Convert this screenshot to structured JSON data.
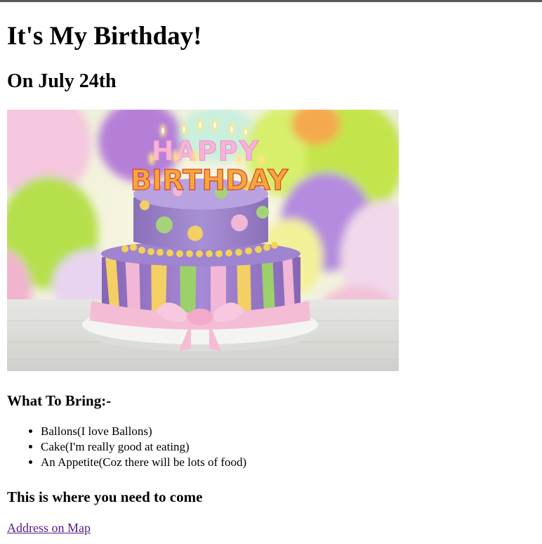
{
  "page": {
    "title": "It's My Birthday!",
    "subtitle": "On July 24th",
    "image": {
      "description_icon": "birthday-cake-icon",
      "cake_text_line1": "HAPPY",
      "cake_text_line2": "BIRTHDAY"
    },
    "bring_heading": "What To Bring:-",
    "bring_items": [
      "Ballons(I love Ballons)",
      "Cake(I'm really good at eating)",
      "An Appetite(Coz there will be lots of food)"
    ],
    "location_heading": "This is where you need to come",
    "map_link_text": "Address on Map"
  },
  "colors": {
    "link_visited": "#551a8b",
    "text": "#000000",
    "background": "#ffffff"
  }
}
